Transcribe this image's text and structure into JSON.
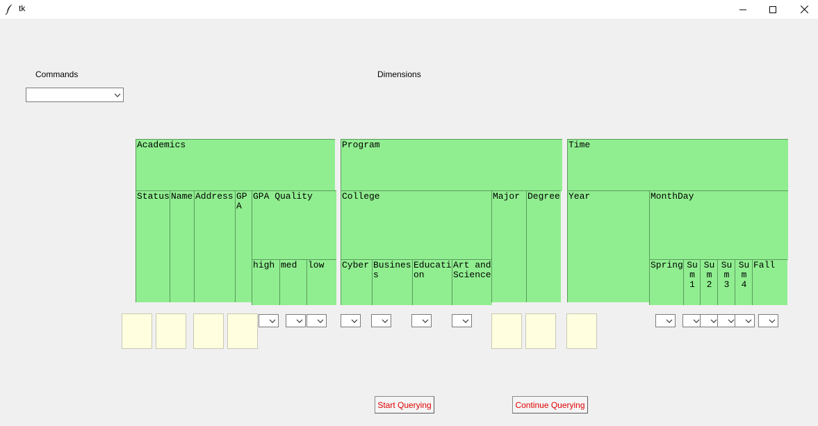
{
  "window": {
    "title": "tk"
  },
  "labels": {
    "commands": "Commands",
    "dimensions": "Dimensions"
  },
  "commands_combo": {
    "value": ""
  },
  "academics": {
    "title": "Academics",
    "status": "Status",
    "name": "Name",
    "address": "Address",
    "gpa": "GPA",
    "gpa_quality": "GPA Quality",
    "high": "high",
    "med": "med",
    "low": "low"
  },
  "program": {
    "title": "Program",
    "college": "College",
    "cyber": "Cyber",
    "business": "Business",
    "education": "Education",
    "arts": "Art and Science",
    "major": "Major",
    "degree": "Degree"
  },
  "time": {
    "title": "Time",
    "year": "Year",
    "monthday": "MonthDay",
    "spring": "Spring",
    "sum1": "Sum 1",
    "sum2": "Sum 2",
    "sum3": "Sum 3",
    "sum4": "Sum 4",
    "fall": "Fall"
  },
  "buttons": {
    "start": "Start Querying",
    "continue": "Continue Querying"
  },
  "icons": {
    "app": "feather-icon",
    "minimize": "minimize-icon",
    "maximize": "maximize-icon",
    "close": "close-icon",
    "dropdown": "chevron-down-icon"
  },
  "colors": {
    "header_green": "#90ee90",
    "entry_yellow": "#ffffe0",
    "button_text": "#e00000"
  }
}
